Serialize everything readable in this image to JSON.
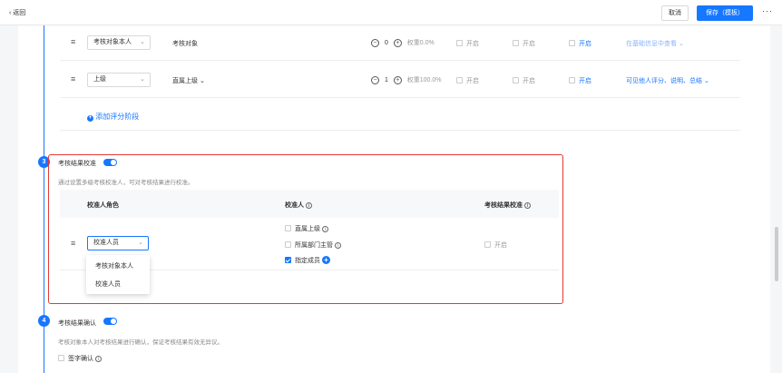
{
  "topbar": {
    "back_label": "‹ 返回",
    "cancel_label": "取消",
    "save_label": "保存（模板）",
    "more_label": "···"
  },
  "stages": {
    "rows": [
      {
        "role": "考核对象本人",
        "name": "考核对象",
        "weight_count": "0",
        "weight_label": "权重0.0%",
        "toggle1": "开启",
        "toggle2": "开启",
        "toggle3": "开启",
        "visibility": "在基础信息中查看 ⌄"
      },
      {
        "role": "上级",
        "name": "直属上级 ⌄",
        "weight_count": "1",
        "weight_label": "权重100.0%",
        "toggle1": "开启",
        "toggle2": "开启",
        "toggle3": "开启",
        "visibility": "可见他人评分、说明、总结 ⌄"
      }
    ],
    "add_label": "添加评分阶段"
  },
  "calibration": {
    "step": "3",
    "title": "考核结果校准",
    "description": "通过设置多级考核校准人，可对考核结果进行校准。",
    "headers": {
      "role": "校准人角色",
      "calibrator": "校准人",
      "result": "考核结果校准"
    },
    "row": {
      "role_value": "校准人员",
      "options": [
        {
          "label": "直属上级",
          "checked": false
        },
        {
          "label": "所属部门主管",
          "checked": false
        },
        {
          "label": "指定成员",
          "checked": true
        }
      ],
      "result_toggle": "开启"
    },
    "dropdown_options": [
      "考核对象本人",
      "校准人员"
    ]
  },
  "confirmation": {
    "step": "4",
    "title": "考核结果确认",
    "description": "考核对象本人对考核结果进行确认，保证考核结果有效无异议。",
    "sign_label": "签字确认"
  },
  "colors": {
    "accent": "#1677ff",
    "highlight_border": "#e53935"
  }
}
